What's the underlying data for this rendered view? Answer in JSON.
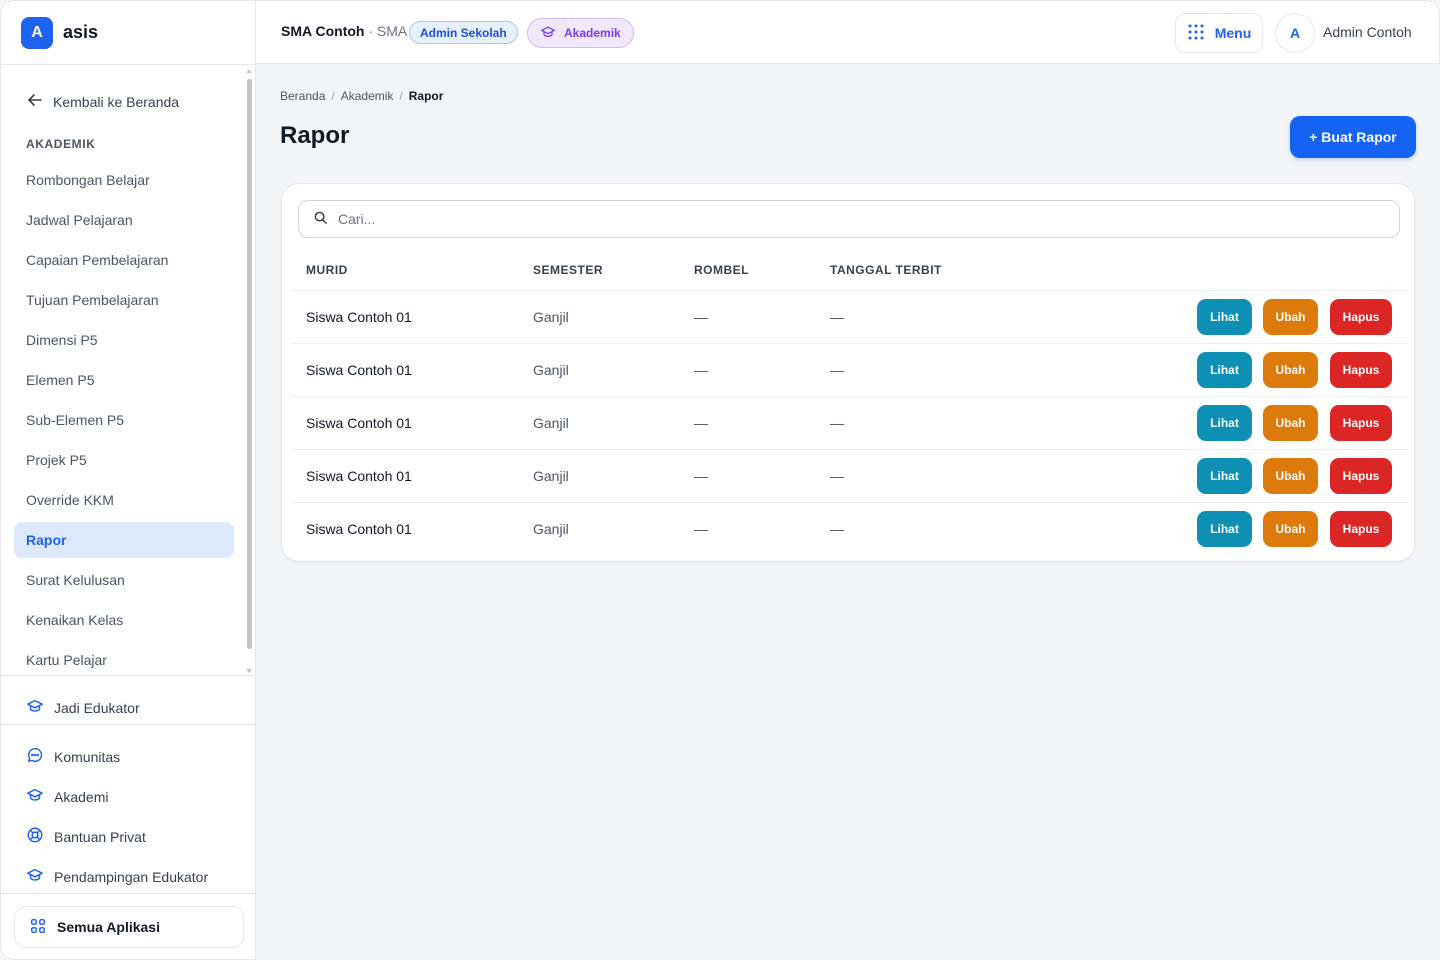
{
  "brand": {
    "logo_letter": "A",
    "name": "asis"
  },
  "sidebar": {
    "back_label": "Kembali ke Beranda",
    "section_label": "AKADEMIK",
    "items": [
      {
        "label": "Rombongan Belajar"
      },
      {
        "label": "Jadwal Pelajaran"
      },
      {
        "label": "Capaian Pembelajaran"
      },
      {
        "label": "Tujuan Pembelajaran"
      },
      {
        "label": "Dimensi P5"
      },
      {
        "label": "Elemen P5"
      },
      {
        "label": "Sub-Elemen P5"
      },
      {
        "label": "Projek P5"
      },
      {
        "label": "Override KKM"
      },
      {
        "label": "Rapor",
        "active": true
      },
      {
        "label": "Surat Kelulusan"
      },
      {
        "label": "Kenaikan Kelas"
      },
      {
        "label": "Kartu Pelajar"
      }
    ],
    "educator_link": "Jadi Edukator",
    "extra_links": [
      {
        "label": "Komunitas",
        "icon": "chat-icon"
      },
      {
        "label": "Akademi",
        "icon": "graduation-cap-icon"
      },
      {
        "label": "Bantuan Privat",
        "icon": "lifebuoy-icon"
      },
      {
        "label": "Pendampingan Edukator",
        "icon": "graduation-cap-icon"
      }
    ],
    "all_apps_label": "Semua Aplikasi"
  },
  "topbar": {
    "school_name": "SMA Contoh",
    "school_sep": " · ",
    "school_level": "SMA",
    "role_badge": "Admin Sekolah",
    "module_badge": "Akademik",
    "menu_label": "Menu",
    "avatar_letter": "A",
    "user_name": "Admin Contoh"
  },
  "breadcrumb": [
    "Beranda",
    "Akademik",
    "Rapor"
  ],
  "page": {
    "title": "Rapor",
    "create_label": "+ Buat Rapor"
  },
  "search": {
    "placeholder": "Cari..."
  },
  "table": {
    "headers": [
      "MURID",
      "SEMESTER",
      "ROMBEL",
      "TANGGAL TERBIT"
    ],
    "rows": [
      {
        "murid": "Siswa Contoh 01",
        "semester": "Ganjil",
        "rombel": "—",
        "tanggal": "—"
      },
      {
        "murid": "Siswa Contoh 01",
        "semester": "Ganjil",
        "rombel": "—",
        "tanggal": "—"
      },
      {
        "murid": "Siswa Contoh 01",
        "semester": "Ganjil",
        "rombel": "—",
        "tanggal": "—"
      },
      {
        "murid": "Siswa Contoh 01",
        "semester": "Ganjil",
        "rombel": "—",
        "tanggal": "—"
      },
      {
        "murid": "Siswa Contoh 01",
        "semester": "Ganjil",
        "rombel": "—",
        "tanggal": "—"
      }
    ],
    "actions": {
      "view": "Lihat",
      "edit": "Ubah",
      "delete": "Hapus"
    }
  },
  "colors": {
    "accent": "#1463f3",
    "view": "#0e90b5",
    "edit": "#dc7a0b",
    "delete": "#dc2626",
    "active_bg": "#dce8fb"
  }
}
